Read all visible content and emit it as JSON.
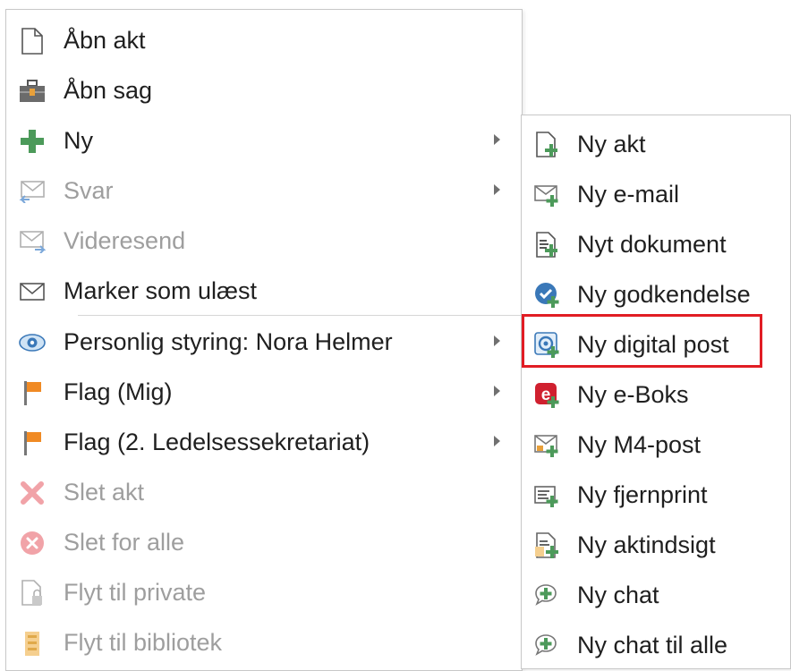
{
  "main_menu": {
    "items": [
      {
        "label": "Åbn akt",
        "icon": "document-icon",
        "state": "enabled"
      },
      {
        "label": "Åbn sag",
        "icon": "briefcase-icon",
        "state": "enabled"
      },
      {
        "label": "Ny",
        "icon": "plus-icon",
        "state": "enabled",
        "submenu": true
      },
      {
        "label": "Svar",
        "icon": "reply-mail-icon",
        "state": "disabled",
        "submenu": true
      },
      {
        "label": "Videresend",
        "icon": "forward-mail-icon",
        "state": "disabled"
      },
      {
        "label": "Marker som ulæst",
        "icon": "envelope-icon",
        "state": "enabled"
      },
      {
        "label": "Personlig styring: Nora Helmer",
        "icon": "eye-icon",
        "state": "enabled",
        "submenu": true
      },
      {
        "label": "Flag (Mig)",
        "icon": "flag-icon",
        "state": "enabled",
        "submenu": true
      },
      {
        "label": "Flag (2. Ledelsessekretariat)",
        "icon": "flag-icon",
        "state": "enabled",
        "submenu": true
      },
      {
        "label": "Slet akt",
        "icon": "delete-x-icon",
        "state": "disabled"
      },
      {
        "label": "Slet for alle",
        "icon": "delete-circle-icon",
        "state": "disabled"
      },
      {
        "label": "Flyt til private",
        "icon": "lock-document-icon",
        "state": "disabled"
      },
      {
        "label": "Flyt til bibliotek",
        "icon": "library-icon",
        "state": "disabled"
      }
    ]
  },
  "sub_menu": {
    "items": [
      {
        "label": "Ny akt",
        "icon": "new-document-icon"
      },
      {
        "label": "Ny e-mail",
        "icon": "new-email-icon"
      },
      {
        "label": "Nyt dokument",
        "icon": "new-text-document-icon"
      },
      {
        "label": "Ny godkendelse",
        "icon": "new-approval-icon"
      },
      {
        "label": "Ny digital post",
        "icon": "new-digital-post-icon",
        "highlighted": true
      },
      {
        "label": "Ny e-Boks",
        "icon": "eboks-icon"
      },
      {
        "label": "Ny M4-post",
        "icon": "new-m4-post-icon"
      },
      {
        "label": "Ny fjernprint",
        "icon": "new-remote-print-icon"
      },
      {
        "label": "Ny aktindsigt",
        "icon": "new-access-request-icon"
      },
      {
        "label": "Ny chat",
        "icon": "new-chat-icon"
      },
      {
        "label": "Ny chat til alle",
        "icon": "new-chat-all-icon"
      }
    ]
  },
  "colors": {
    "highlight_border": "#e11d24",
    "disabled_text": "#9e9e9e",
    "plus_green": "#4c9a5a",
    "flag_orange": "#f08a24",
    "eboks_red": "#d0202f"
  }
}
